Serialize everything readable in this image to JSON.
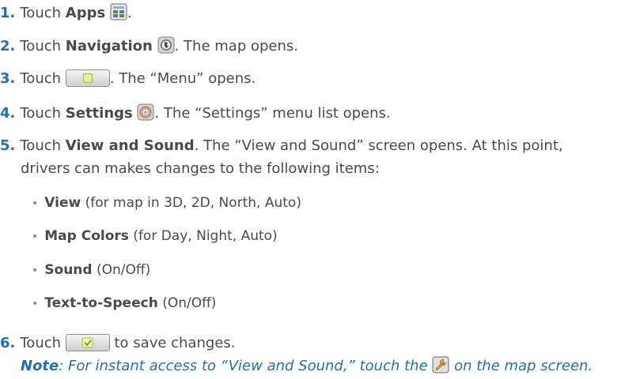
{
  "steps": [
    {
      "num": "1.",
      "pre": "Touch ",
      "bold": "Apps",
      "post": ".",
      "icon": "apps-grid-icon"
    },
    {
      "num": "2.",
      "pre": "Touch ",
      "bold": "Navigation",
      "post": ". The map opens.",
      "icon": "navigation-globe-icon"
    },
    {
      "num": "3.",
      "pre": "Touch ",
      "post": ". The “Menu” opens.",
      "icon": "menu-button-icon"
    },
    {
      "num": "4.",
      "pre": "Touch ",
      "bold": "Settings",
      "post": ". The “Settings” menu list opens.",
      "icon": "settings-gear-icon"
    },
    {
      "num": "5.",
      "pre": "Touch ",
      "bold": "View and Sound",
      "post": ". The “View and Sound” screen opens. At this point,",
      "cont": "drivers can makes changes to the following items:"
    },
    {
      "num": "6.",
      "pre": "Touch ",
      "post": " to save changes.",
      "icon": "save-check-icon"
    }
  ],
  "bullets": [
    {
      "bold": "View",
      "text": " (for map in 3D, 2D, North, Auto)"
    },
    {
      "bold": "Map Colors",
      "text": " (for Day, Night, Auto)"
    },
    {
      "bold": "Sound",
      "text": " (On/Off)"
    },
    {
      "bold": "Text-to-Speech",
      "text": " (On/Off)"
    }
  ],
  "bullet_char": "•",
  "note": {
    "label": "Note",
    "text1": ": For instant access to “View and Sound,” touch the ",
    "text2": " on the map screen.",
    "icon": "wrench-icon"
  },
  "colors": {
    "accent": "#1f70b5",
    "text": "#4a4a4a"
  }
}
